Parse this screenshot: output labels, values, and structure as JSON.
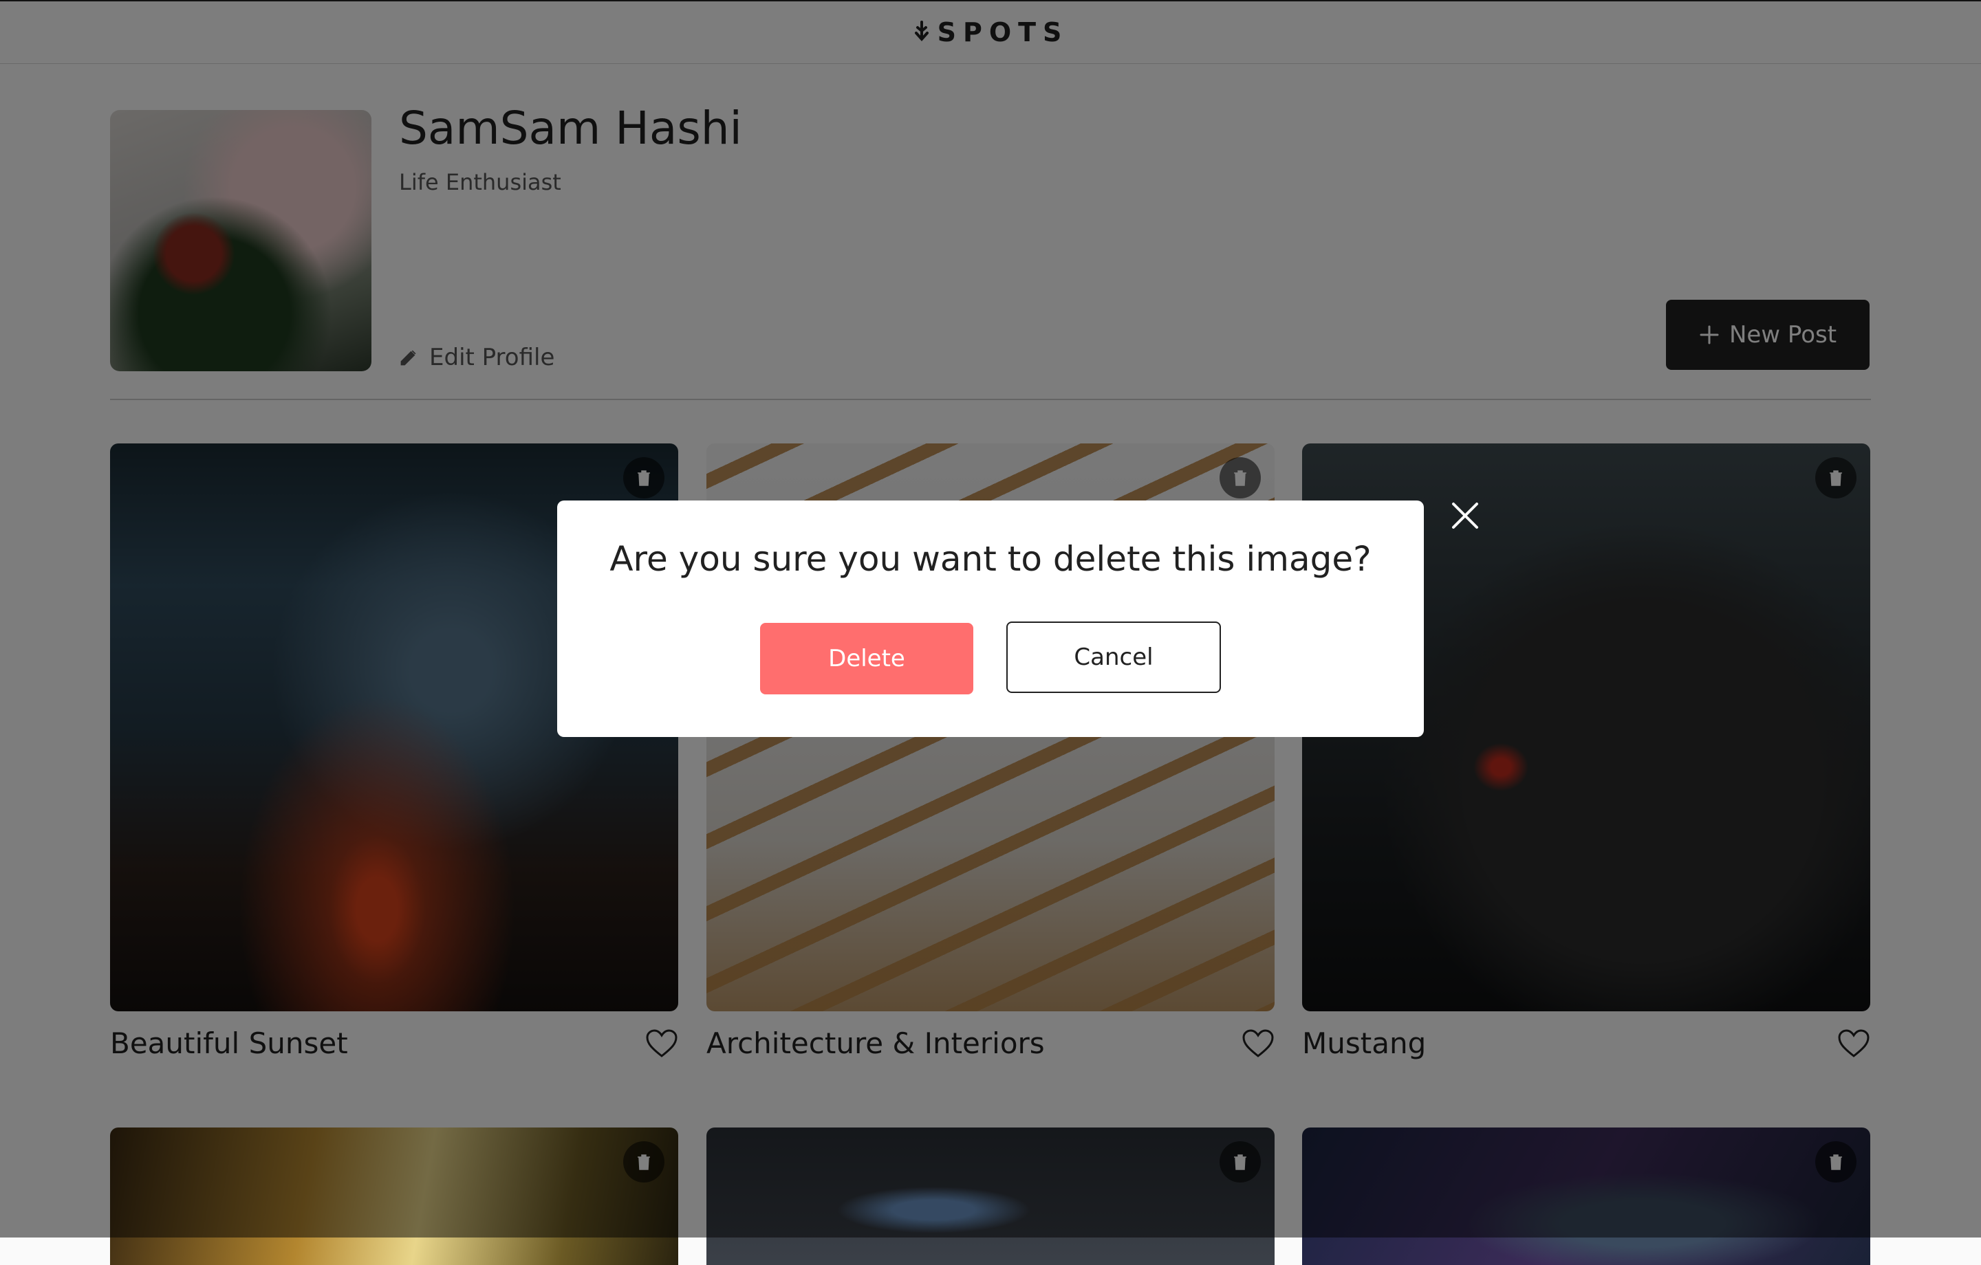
{
  "header": {
    "logo_text": "SPOTS",
    "logo_icon": "spots-logo-icon"
  },
  "profile": {
    "name": "SamSam Hashi",
    "description": "Life Enthusiast",
    "edit_label": "Edit Profile",
    "edit_icon": "pencil-icon",
    "new_post_label": "New Post",
    "new_post_icon": "plus-icon"
  },
  "cards": [
    {
      "title": "Beautiful Sunset"
    },
    {
      "title": "Architecture & Interiors"
    },
    {
      "title": "Mustang"
    },
    {
      "title": ""
    },
    {
      "title": ""
    },
    {
      "title": ""
    }
  ],
  "card_icons": {
    "delete": "trash-icon",
    "like": "heart-icon"
  },
  "modal": {
    "title": "Are you sure you want to delete this image?",
    "delete_label": "Delete",
    "cancel_label": "Cancel",
    "close_icon": "close-icon"
  },
  "colors": {
    "text": "#212121",
    "delete_button": "#ff6e6e",
    "new_post_button": "#212121",
    "overlay": "rgba(0,0,0,0.5)"
  }
}
